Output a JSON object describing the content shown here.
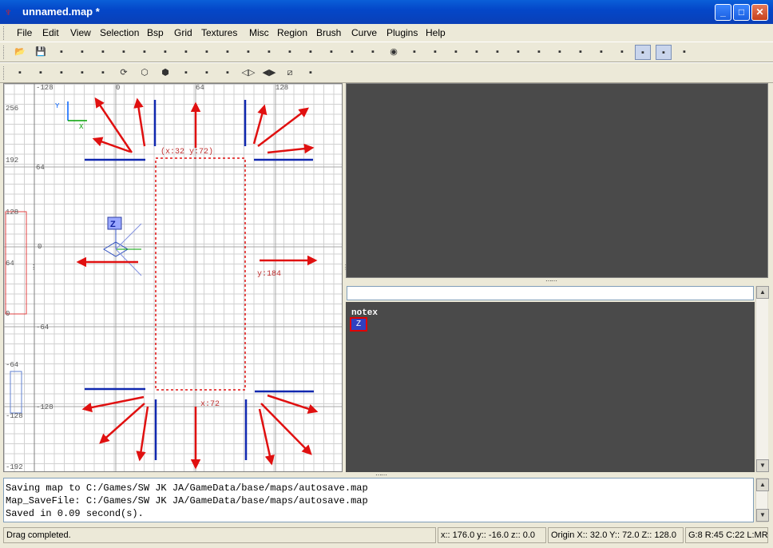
{
  "window": {
    "title": "unnamed.map *"
  },
  "menu": [
    "File",
    "Edit",
    "View",
    "Selection",
    "Bsp",
    "Grid",
    "Textures",
    "Misc",
    "Region",
    "Brush",
    "Curve",
    "Plugins",
    "Help"
  ],
  "toolbar1": [
    "open-icon",
    "save-icon",
    "x-axis-flip-icon",
    "x-axis-rotate-icon",
    "y-axis-flip-icon",
    "y-axis-rotate-icon",
    "z-axis-flip-icon",
    "z-axis-rotate-icon",
    "complete-tall-icon",
    "size-to-fit-icon",
    "select-inside-icon",
    "select-touching-icon",
    "csg-subtract-icon",
    "csg-merge-icon",
    "hollow-icon",
    "clipper-icon",
    "change-view-icon",
    "texture-lock-icon",
    "camera-icon",
    "view-front-icon",
    "view-x-icon",
    "view-y-icon",
    "view-z-icon",
    "hide-detail-icon",
    "curve-edit-icon",
    "patch-icon",
    "patch-bend-icon",
    "brush-3-sided-icon",
    "patch-inspector-icon",
    "dont-select-curve-icon",
    "select-vertex-icon",
    "select-edge-icon",
    "brush-cube-icon"
  ],
  "toolbar2": [
    "rotate-mode-icon",
    "scale-mode-icon",
    "drag-mode-icon",
    "patch-cap-icon",
    "texture-view-icon",
    "refresh-icon",
    "cycle-icon",
    "entity-icon",
    "tree-icon",
    "train-icon",
    "region-icon",
    "mirror-icon",
    "mirror-2-icon",
    "clip-icon",
    "camera-clip-icon"
  ],
  "view2d": {
    "top_labels": [
      "-128",
      "0",
      "64",
      "128"
    ],
    "left_labels": [
      "256",
      "192",
      "128",
      "64",
      "0",
      "-64",
      "-128",
      "-192"
    ],
    "inner_labels": [
      "64",
      "0",
      "-64",
      "-128"
    ],
    "dim_top": "(x:32  y:72)",
    "dim_right": "y:184",
    "dim_bottom": "x:72",
    "axis_x": "X",
    "axis_y": "Y",
    "z_badge": "Z"
  },
  "texture_browser": {
    "search_value": "",
    "texture_name": "notex",
    "thumb_letter": "Z"
  },
  "console": {
    "lines": [
      "Saving map to C:/Games/SW JK JA/GameData/base/maps/autosave.map",
      "Map_SaveFile: C:/Games/SW JK JA/GameData/base/maps/autosave.map",
      "Saved in 0.09 second(s)."
    ]
  },
  "status": {
    "message": "Drag completed.",
    "coords": "x:: 176.0  y:: -16.0  z:: 0.0",
    "origin": "Origin X:: 32.0  Y:: 72.0  Z:: 128.0",
    "grid": "G:8 R:45 C:22 L:MR"
  },
  "colors": {
    "arrow": "#e01010",
    "brush_outline": "#e01010",
    "bracket": "#1028b0",
    "titlebar": "#0a4fd0",
    "viewport_bg": "#4a4a4a"
  }
}
